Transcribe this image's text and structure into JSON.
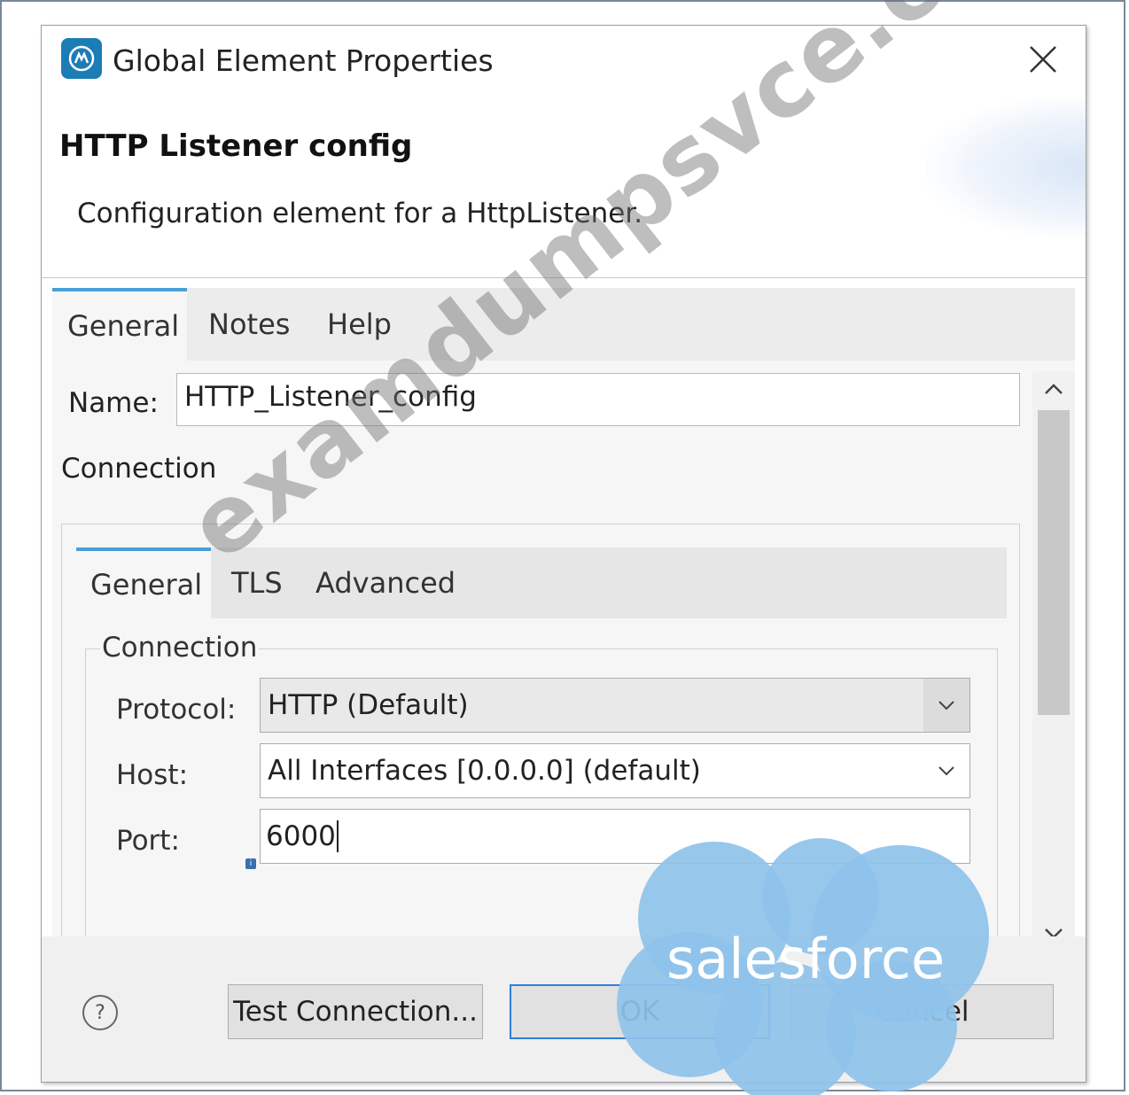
{
  "window": {
    "title": "Global Element Properties",
    "app_icon": "mule-studio-icon",
    "close_icon": "close-icon"
  },
  "header": {
    "title": "HTTP Listener config",
    "description": "Configuration element for a HttpListener."
  },
  "tabs": [
    {
      "label": "General",
      "active": true
    },
    {
      "label": "Notes",
      "active": false
    },
    {
      "label": "Help",
      "active": false
    }
  ],
  "form": {
    "name_label": "Name:",
    "name_value": "HTTP_Listener_config",
    "connection_label": "Connection",
    "connection_tabs": [
      {
        "label": "General",
        "active": true
      },
      {
        "label": "TLS",
        "active": false
      },
      {
        "label": "Advanced",
        "active": false
      }
    ],
    "group_label": "Connection",
    "protocol_label": "Protocol:",
    "protocol_value": "HTTP (Default)",
    "host_label": "Host:",
    "host_value": "All Interfaces [0.0.0.0] (default)",
    "port_label": "Port:",
    "port_value": "6000"
  },
  "footer": {
    "help_symbol": "?",
    "test_connection_label": "Test Connection...",
    "ok_label": "OK",
    "cancel_label": "Cancel"
  },
  "overlay": {
    "watermark": "examdumpsvce.com",
    "brand_text": "salesforce",
    "brand_color": "#8fc2ea"
  },
  "colors": {
    "accent": "#4a9fd8",
    "default_button_border": "#2f7fd8",
    "tab_bar": "#ececec"
  }
}
